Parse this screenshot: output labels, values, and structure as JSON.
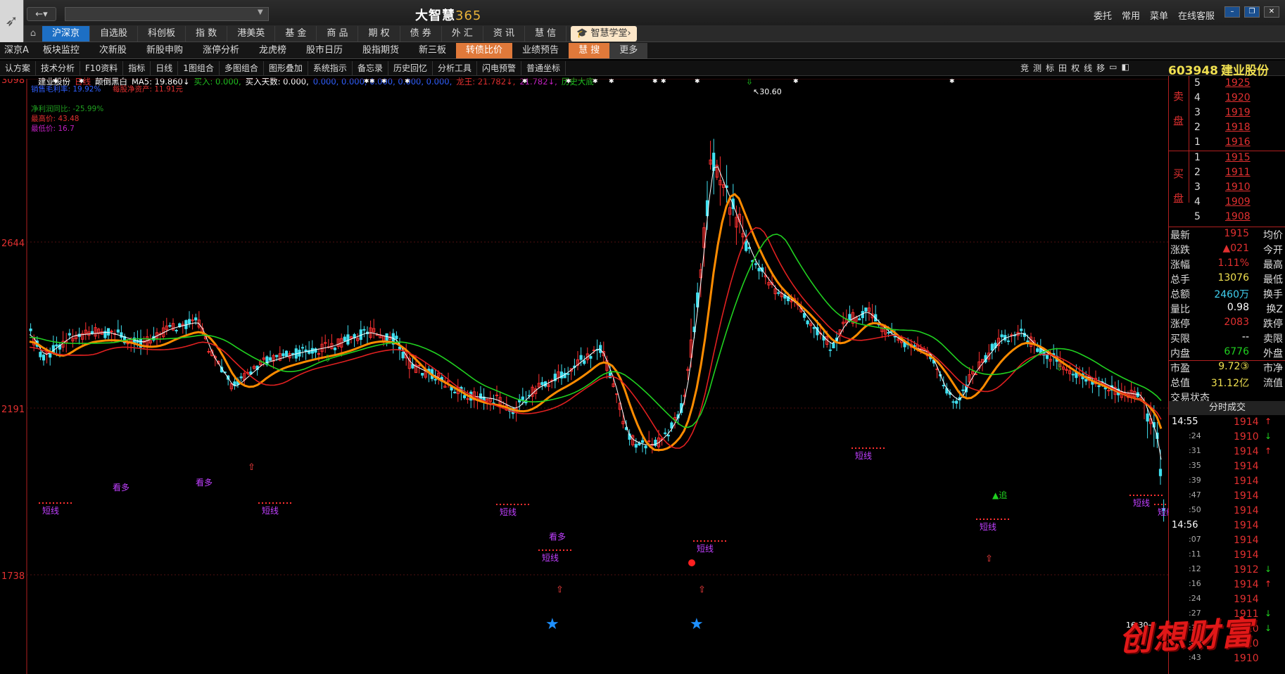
{
  "app": {
    "title_text": "大智慧",
    "title_num": "365",
    "search_placeholder": ""
  },
  "top_menu": [
    "委托",
    "常用",
    "菜单",
    "在线客服"
  ],
  "tabs_row1": [
    {
      "label": "沪深京",
      "active": true
    },
    {
      "label": "自选股"
    },
    {
      "label": "科创板"
    },
    {
      "label": "指  数"
    },
    {
      "label": "港美英"
    },
    {
      "label": "基  金"
    },
    {
      "label": "商  品"
    },
    {
      "label": "期  权"
    },
    {
      "label": "债  券"
    },
    {
      "label": "外  汇"
    },
    {
      "label": "资  讯"
    },
    {
      "label": "慧  信"
    }
  ],
  "school_label": "智慧学堂",
  "tabs_row2": [
    {
      "label": "深京A"
    },
    {
      "label": "板块监控"
    },
    {
      "label": "次新股"
    },
    {
      "label": "新股申购"
    },
    {
      "label": "涨停分析"
    },
    {
      "label": "龙虎榜"
    },
    {
      "label": "股市日历"
    },
    {
      "label": "股指期货"
    },
    {
      "label": "新三板"
    },
    {
      "label": "转债比价",
      "orange": true
    },
    {
      "label": "业绩预告"
    },
    {
      "label": "慧  搜",
      "orange": true
    },
    {
      "label": "更多",
      "more": true
    }
  ],
  "toolbar": [
    "认方案",
    "技术分析",
    "F10资料",
    "指标",
    "日线",
    "1图组合",
    "多图组合",
    "图形叠加",
    "系统指示",
    "备忘录",
    "历史回忆",
    "分析工具",
    "闪电预警",
    "普通坐标"
  ],
  "toolbar_icons": [
    "竞",
    "测",
    "标",
    "田",
    "权",
    "线",
    "移",
    "▭",
    "◧"
  ],
  "stock": {
    "code": "603948",
    "name": "建业股份"
  },
  "indicator_line": [
    {
      "text": "建业股份",
      "color": "#ffffff"
    },
    {
      "text": "日线",
      "color": "#e23030"
    },
    {
      "text": "颠倒黑白",
      "color": "#ffffff"
    },
    {
      "text": "MA5: 19.860↓",
      "color": "#ffffff"
    },
    {
      "text": "买入: 0.000,",
      "color": "#20c020"
    },
    {
      "text": "买入天数: 0.000,",
      "color": "#ffffff"
    },
    {
      "text": "0.000, 0.000, 0.000, 0.000, 0.000,",
      "color": "#3060ff"
    },
    {
      "text": "龙王: 21.782↓,",
      "color": "#e23030"
    },
    {
      "text": "21.782↓,",
      "color": "#c020c0"
    },
    {
      "text": "历史大底",
      "color": "#20c020"
    }
  ],
  "chart_notes": [
    {
      "text": "销售毛利率: 19.92%",
      "color": "#3060ff"
    },
    {
      "text": "每股净资产: 11.91元",
      "color": "#e23030"
    },
    {
      "text": "净利润同比: -25.99%",
      "color": "#20a020"
    },
    {
      "text": "最高价: 43.48",
      "color": "#e23030"
    },
    {
      "text": "最低价: 16.7",
      "color": "#c020c0"
    }
  ],
  "y_labels": [
    "3098",
    "2644",
    "2191",
    "1738"
  ],
  "peak_label": "30.60",
  "low_label": "16.30",
  "chart_text_labels": {
    "duanxian": "短线",
    "kanduo": "看多",
    "zhui": "追"
  },
  "orderbook": {
    "sell_label": [
      "卖",
      "盘"
    ],
    "buy_label": [
      "买",
      "盘"
    ],
    "sell": [
      {
        "level": "5",
        "price": "1925"
      },
      {
        "level": "4",
        "price": "1920"
      },
      {
        "level": "3",
        "price": "1919"
      },
      {
        "level": "2",
        "price": "1918"
      },
      {
        "level": "1",
        "price": "1916"
      }
    ],
    "buy": [
      {
        "level": "1",
        "price": "1915"
      },
      {
        "level": "2",
        "price": "1911"
      },
      {
        "level": "3",
        "price": "1910"
      },
      {
        "level": "4",
        "price": "1909"
      },
      {
        "level": "5",
        "price": "1908"
      }
    ]
  },
  "stats": [
    {
      "label": "最新",
      "value": "1915",
      "color": "#e23030",
      "label2": "均价"
    },
    {
      "label": "涨跌",
      "value": "▲021",
      "color": "#e23030",
      "label2": "今开"
    },
    {
      "label": "涨幅",
      "value": "1.11%",
      "color": "#e23030",
      "label2": "最高"
    },
    {
      "label": "总手",
      "value": "13076",
      "color": "#f0e050",
      "label2": "最低"
    },
    {
      "label": "总额",
      "value": "2460万",
      "color": "#40d0f0",
      "label2": "换手"
    },
    {
      "label": "量比",
      "value": "0.98",
      "color": "#ffffff",
      "label2": "换Z"
    },
    {
      "label": "涨停",
      "value": "2083",
      "color": "#e23030",
      "label2": "跌停"
    },
    {
      "label": "买限",
      "value": "--",
      "color": "#ffffff",
      "label2": "卖限"
    },
    {
      "label": "内盘",
      "value": "6776",
      "color": "#20d020",
      "label2": "外盘"
    },
    {
      "label": "市盈",
      "value": "9.72③",
      "color": "#f0e050",
      "label2": "市净"
    },
    {
      "label": "总值",
      "value": "31.12亿",
      "color": "#f0e050",
      "label2": "流值"
    },
    {
      "label": "交易状态",
      "value": "",
      "color": "#ffffff",
      "label2": ""
    }
  ],
  "timesales_header": "分时成交",
  "timesales": [
    {
      "time": "14:55",
      "sub": "",
      "price": "1914",
      "dir": "up"
    },
    {
      "time": "",
      "sub": ":24",
      "price": "1910",
      "dir": "down"
    },
    {
      "time": "",
      "sub": ":31",
      "price": "1914",
      "dir": "up"
    },
    {
      "time": "",
      "sub": ":35",
      "price": "1914",
      "dir": ""
    },
    {
      "time": "",
      "sub": ":39",
      "price": "1914",
      "dir": ""
    },
    {
      "time": "",
      "sub": ":47",
      "price": "1914",
      "dir": ""
    },
    {
      "time": "",
      "sub": ":50",
      "price": "1914",
      "dir": ""
    },
    {
      "time": "14:56",
      "sub": "",
      "price": "1914",
      "dir": ""
    },
    {
      "time": "",
      "sub": ":07",
      "price": "1914",
      "dir": ""
    },
    {
      "time": "",
      "sub": ":11",
      "price": "1914",
      "dir": ""
    },
    {
      "time": "",
      "sub": ":12",
      "price": "1912",
      "dir": "down"
    },
    {
      "time": "",
      "sub": ":16",
      "price": "1914",
      "dir": "up"
    },
    {
      "time": "",
      "sub": ":24",
      "price": "1914",
      "dir": ""
    },
    {
      "time": "",
      "sub": ":27",
      "price": "1911",
      "dir": "down"
    },
    {
      "time": "",
      "sub": ":32",
      "price": "1910",
      "dir": "down"
    },
    {
      "time": "",
      "sub": ":40",
      "price": "1910",
      "dir": ""
    },
    {
      "time": "",
      "sub": ":43",
      "price": "1910",
      "dir": ""
    }
  ],
  "watermark": "创想财富"
}
